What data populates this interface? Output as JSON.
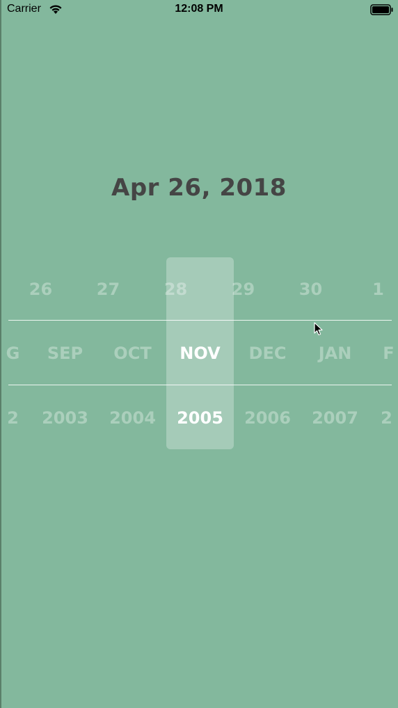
{
  "status_bar": {
    "carrier": "Carrier",
    "time": "12:08 PM",
    "wifi_icon": "wifi-icon",
    "battery_icon": "battery-icon"
  },
  "selected_date": "Apr 26, 2018",
  "picker": {
    "days": [
      "26",
      "27",
      "28",
      "29",
      "30",
      "1"
    ],
    "months": [
      "G",
      "SEP",
      "OCT",
      "NOV",
      "DEC",
      "JAN",
      "F"
    ],
    "years": [
      "2",
      "2003",
      "2004",
      "2005",
      "2006",
      "2007",
      "2"
    ],
    "selected_day": "28",
    "selected_month": "NOV",
    "selected_year": "2005"
  },
  "colors": {
    "background": "#83b89d",
    "title": "#454545",
    "selected_text": "#ffffff"
  }
}
